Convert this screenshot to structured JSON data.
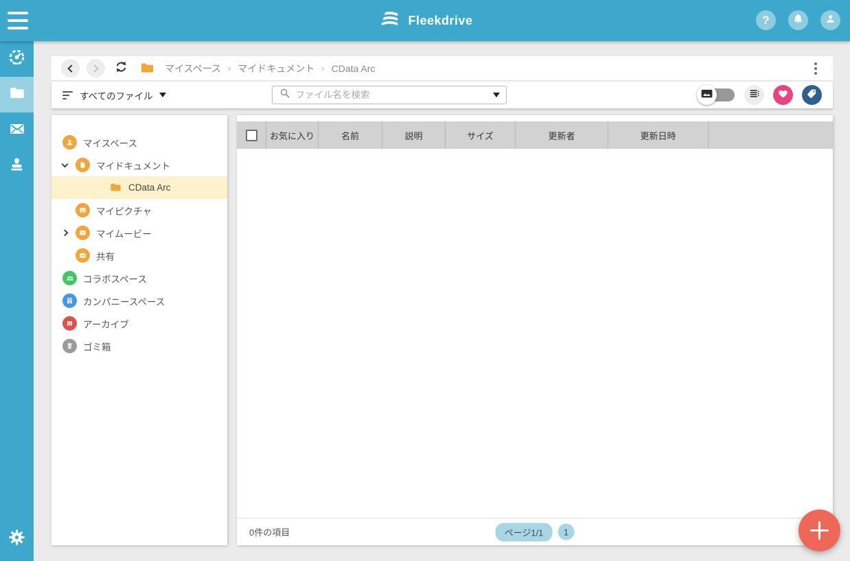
{
  "topbar": {
    "brand": "Fleekdrive",
    "help_glyph": "?"
  },
  "breadcrumb": {
    "separator": "›",
    "items": [
      "マイスペース",
      "マイドキュメント",
      "CData Arc"
    ]
  },
  "filterbar": {
    "filter_label": "すべてのファイル",
    "search_placeholder": "ファイル名を検索",
    "search_value": ""
  },
  "tree": {
    "items": [
      {
        "label": "マイスペース",
        "icon": "user-space",
        "color": "#f0a63c",
        "level": 0
      },
      {
        "label": "マイドキュメント",
        "icon": "documents",
        "color": "#f0a63c",
        "level": 1,
        "state": "expanded"
      },
      {
        "label": "CData Arc",
        "icon": "folder",
        "color": "#f0a63c",
        "level": 2,
        "state": "selected"
      },
      {
        "label": "マイピクチャ",
        "icon": "pictures",
        "color": "#f0a63c",
        "level": 1
      },
      {
        "label": "マイムービー",
        "icon": "movies",
        "color": "#f0a63c",
        "level": 1,
        "state": "collapsed"
      },
      {
        "label": "共有",
        "icon": "shared",
        "color": "#f0a63c",
        "level": 1
      },
      {
        "label": "コラボスペース",
        "icon": "collab-space",
        "color": "#45c463",
        "level": 0
      },
      {
        "label": "カンパニースペース",
        "icon": "company-space",
        "color": "#4596e8",
        "level": 0
      },
      {
        "label": "アーカイブ",
        "icon": "archive",
        "color": "#d9534f",
        "level": 0
      },
      {
        "label": "ゴミ箱",
        "icon": "trash",
        "color": "#9a9a9a",
        "level": 0
      }
    ]
  },
  "table": {
    "columns": [
      "お気に入り",
      "名前",
      "説明",
      "サイズ",
      "更新者",
      "更新日時"
    ]
  },
  "footer": {
    "item_count": "0件の項目",
    "page_label": "ページ1/1",
    "page_number": "1"
  },
  "icons": {
    "menu": "hamburger-lines",
    "help": "question-mark",
    "notifications": "bell",
    "account": "person",
    "dashboard": "speedometer",
    "files": "folder",
    "mail": "envelope",
    "approval": "stamp",
    "settings": "gear",
    "back": "chevron-left",
    "forward": "chevron-right",
    "refresh": "circular-arrows",
    "more": "kebab-dots",
    "filter": "filter-lines",
    "search": "magnifier",
    "view_mode": "thumbnail-toggle-switch",
    "list_view": "list-lines",
    "favorites": "heart",
    "tags": "tag",
    "add": "plus"
  },
  "colors": {
    "topbar": "#3da8cb",
    "accent_orange": "#f0a63c",
    "selected_tree_row": "#fcf2cb",
    "table_header": "#d2d2d2",
    "fab": "#ee685a",
    "heart_button": "#e8457e",
    "tag_button": "#2e6191",
    "collab_green": "#45c463",
    "company_blue": "#4596e8",
    "archive_red": "#d9534f",
    "trash_gray": "#9a9a9a",
    "pager_pill": "#a9d6e5"
  }
}
